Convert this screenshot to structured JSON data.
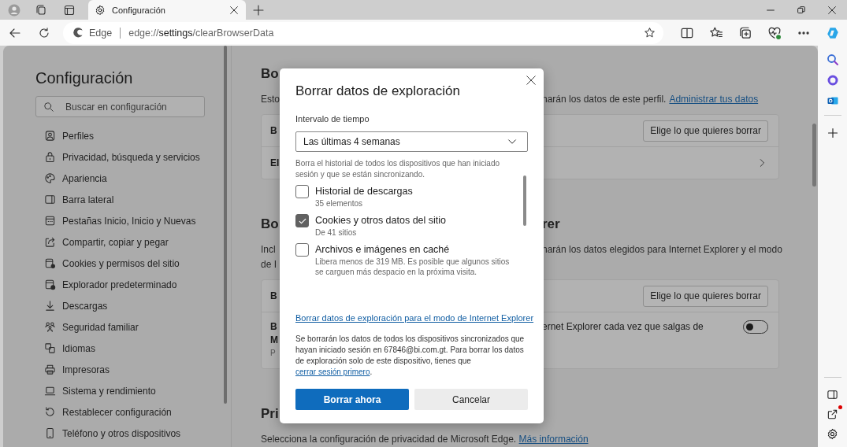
{
  "tab_strip": {
    "tabs": [
      {
        "title": "Configuración",
        "selected": true
      }
    ]
  },
  "address_bar": {
    "site_name": "Edge",
    "url_scheme": "edge://",
    "url_page": "settings",
    "url_path": "/clearBrowserData"
  },
  "settings_nav": {
    "title": "Configuración",
    "search": {
      "placeholder": "Buscar en configuración"
    },
    "items": [
      {
        "label": "Perfiles"
      },
      {
        "label": "Privacidad, búsqueda y servicios"
      },
      {
        "label": "Apariencia"
      },
      {
        "label": "Barra lateral"
      },
      {
        "label": "Pestañas Inicio, Inicio y Nuevas"
      },
      {
        "label": "Compartir, copiar y pegar"
      },
      {
        "label": "Cookies y permisos del sitio"
      },
      {
        "label": "Explorador predeterminado"
      },
      {
        "label": "Descargas"
      },
      {
        "label": "Seguridad familiar"
      },
      {
        "label": "Idiomas"
      },
      {
        "label": "Impresoras"
      },
      {
        "label": "Sistema y rendimiento"
      },
      {
        "label": "Restablecer configuración"
      },
      {
        "label": "Teléfono y otros dispositivos"
      }
    ]
  },
  "sections": [
    {
      "heading": {
        "start": "Bo"
      },
      "lines": [
        {
          "start": "Esto",
          "end": "narán los datos de este perfil.",
          "link": "Administrar tus datos"
        }
      ],
      "card": [
        {
          "kind": "button",
          "start": "B",
          "button": "Elige lo que quieres borrar"
        },
        {
          "kind": "chevron",
          "start": "El"
        }
      ]
    },
    {
      "heading": {
        "start": "Bo",
        "end": "rer"
      },
      "lines": [
        {
          "start": "Incl",
          "end": "narán los datos elegidos para Internet Explorer y el modo"
        },
        {
          "start": "de I"
        }
      ],
      "card": [
        {
          "kind": "button",
          "start": "B",
          "button": "Elige lo que quieres borrar"
        },
        {
          "kind": "toggle",
          "title_lines": [
            "B",
            "M"
          ],
          "end": "ernet Explorer cada vez que salgas de",
          "note": "P",
          "on": false
        }
      ]
    },
    {
      "heading": {
        "start": "Pri"
      },
      "lines": [
        {
          "text": "Selecciona la configuración de privacidad de Microsoft Edge.",
          "link": "Más información"
        }
      ]
    }
  ],
  "dialog": {
    "title": "Borrar datos de exploración",
    "range": {
      "label": "Intervalo de tiempo",
      "value": "Las últimas 4 semanas"
    },
    "intro": "Borra el historial de todos los dispositivos que han iniciado sesión y que se están sincronizando.",
    "options": [
      {
        "label": "Historial de descargas",
        "detail": "35 elementos",
        "checked": false
      },
      {
        "label": "Cookies y otros datos del sitio",
        "detail": "De 41 sitios",
        "checked": true
      },
      {
        "label": "Archivos e imágenes en caché",
        "detail": "Libera menos de 319 MB. Es posible que algunos sitios se carguen más despacio en la próxima visita.",
        "checked": false
      }
    ],
    "ie_link": "Borrar datos de exploración para el modo de Internet Explorer",
    "notice": {
      "text": "Se borrarán los datos de todos los dispositivos sincronizados que hayan iniciado sesión en 67846@bi.com.gt. Para borrar los datos de exploración solo de este dispositivo, tienes que",
      "link": "cerrar sesión primero",
      "end": "."
    },
    "buttons": [
      {
        "label": "Borrar ahora",
        "kind": "primary"
      },
      {
        "label": "Cancelar",
        "kind": "secondary"
      }
    ]
  }
}
